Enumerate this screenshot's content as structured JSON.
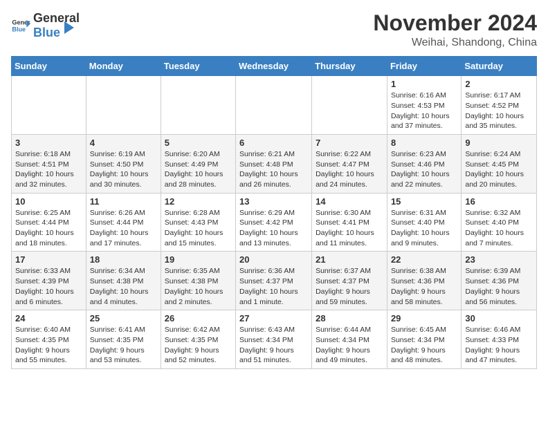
{
  "logo": {
    "general": "General",
    "blue": "Blue"
  },
  "title": {
    "month": "November 2024",
    "location": "Weihai, Shandong, China"
  },
  "weekdays": [
    "Sunday",
    "Monday",
    "Tuesday",
    "Wednesday",
    "Thursday",
    "Friday",
    "Saturday"
  ],
  "weeks": [
    [
      {
        "day": "",
        "info": ""
      },
      {
        "day": "",
        "info": ""
      },
      {
        "day": "",
        "info": ""
      },
      {
        "day": "",
        "info": ""
      },
      {
        "day": "",
        "info": ""
      },
      {
        "day": "1",
        "info": "Sunrise: 6:16 AM\nSunset: 4:53 PM\nDaylight: 10 hours\nand 37 minutes."
      },
      {
        "day": "2",
        "info": "Sunrise: 6:17 AM\nSunset: 4:52 PM\nDaylight: 10 hours\nand 35 minutes."
      }
    ],
    [
      {
        "day": "3",
        "info": "Sunrise: 6:18 AM\nSunset: 4:51 PM\nDaylight: 10 hours\nand 32 minutes."
      },
      {
        "day": "4",
        "info": "Sunrise: 6:19 AM\nSunset: 4:50 PM\nDaylight: 10 hours\nand 30 minutes."
      },
      {
        "day": "5",
        "info": "Sunrise: 6:20 AM\nSunset: 4:49 PM\nDaylight: 10 hours\nand 28 minutes."
      },
      {
        "day": "6",
        "info": "Sunrise: 6:21 AM\nSunset: 4:48 PM\nDaylight: 10 hours\nand 26 minutes."
      },
      {
        "day": "7",
        "info": "Sunrise: 6:22 AM\nSunset: 4:47 PM\nDaylight: 10 hours\nand 24 minutes."
      },
      {
        "day": "8",
        "info": "Sunrise: 6:23 AM\nSunset: 4:46 PM\nDaylight: 10 hours\nand 22 minutes."
      },
      {
        "day": "9",
        "info": "Sunrise: 6:24 AM\nSunset: 4:45 PM\nDaylight: 10 hours\nand 20 minutes."
      }
    ],
    [
      {
        "day": "10",
        "info": "Sunrise: 6:25 AM\nSunset: 4:44 PM\nDaylight: 10 hours\nand 18 minutes."
      },
      {
        "day": "11",
        "info": "Sunrise: 6:26 AM\nSunset: 4:44 PM\nDaylight: 10 hours\nand 17 minutes."
      },
      {
        "day": "12",
        "info": "Sunrise: 6:28 AM\nSunset: 4:43 PM\nDaylight: 10 hours\nand 15 minutes."
      },
      {
        "day": "13",
        "info": "Sunrise: 6:29 AM\nSunset: 4:42 PM\nDaylight: 10 hours\nand 13 minutes."
      },
      {
        "day": "14",
        "info": "Sunrise: 6:30 AM\nSunset: 4:41 PM\nDaylight: 10 hours\nand 11 minutes."
      },
      {
        "day": "15",
        "info": "Sunrise: 6:31 AM\nSunset: 4:40 PM\nDaylight: 10 hours\nand 9 minutes."
      },
      {
        "day": "16",
        "info": "Sunrise: 6:32 AM\nSunset: 4:40 PM\nDaylight: 10 hours\nand 7 minutes."
      }
    ],
    [
      {
        "day": "17",
        "info": "Sunrise: 6:33 AM\nSunset: 4:39 PM\nDaylight: 10 hours\nand 6 minutes."
      },
      {
        "day": "18",
        "info": "Sunrise: 6:34 AM\nSunset: 4:38 PM\nDaylight: 10 hours\nand 4 minutes."
      },
      {
        "day": "19",
        "info": "Sunrise: 6:35 AM\nSunset: 4:38 PM\nDaylight: 10 hours\nand 2 minutes."
      },
      {
        "day": "20",
        "info": "Sunrise: 6:36 AM\nSunset: 4:37 PM\nDaylight: 10 hours\nand 1 minute."
      },
      {
        "day": "21",
        "info": "Sunrise: 6:37 AM\nSunset: 4:37 PM\nDaylight: 9 hours\nand 59 minutes."
      },
      {
        "day": "22",
        "info": "Sunrise: 6:38 AM\nSunset: 4:36 PM\nDaylight: 9 hours\nand 58 minutes."
      },
      {
        "day": "23",
        "info": "Sunrise: 6:39 AM\nSunset: 4:36 PM\nDaylight: 9 hours\nand 56 minutes."
      }
    ],
    [
      {
        "day": "24",
        "info": "Sunrise: 6:40 AM\nSunset: 4:35 PM\nDaylight: 9 hours\nand 55 minutes."
      },
      {
        "day": "25",
        "info": "Sunrise: 6:41 AM\nSunset: 4:35 PM\nDaylight: 9 hours\nand 53 minutes."
      },
      {
        "day": "26",
        "info": "Sunrise: 6:42 AM\nSunset: 4:35 PM\nDaylight: 9 hours\nand 52 minutes."
      },
      {
        "day": "27",
        "info": "Sunrise: 6:43 AM\nSunset: 4:34 PM\nDaylight: 9 hours\nand 51 minutes."
      },
      {
        "day": "28",
        "info": "Sunrise: 6:44 AM\nSunset: 4:34 PM\nDaylight: 9 hours\nand 49 minutes."
      },
      {
        "day": "29",
        "info": "Sunrise: 6:45 AM\nSunset: 4:34 PM\nDaylight: 9 hours\nand 48 minutes."
      },
      {
        "day": "30",
        "info": "Sunrise: 6:46 AM\nSunset: 4:33 PM\nDaylight: 9 hours\nand 47 minutes."
      }
    ]
  ]
}
